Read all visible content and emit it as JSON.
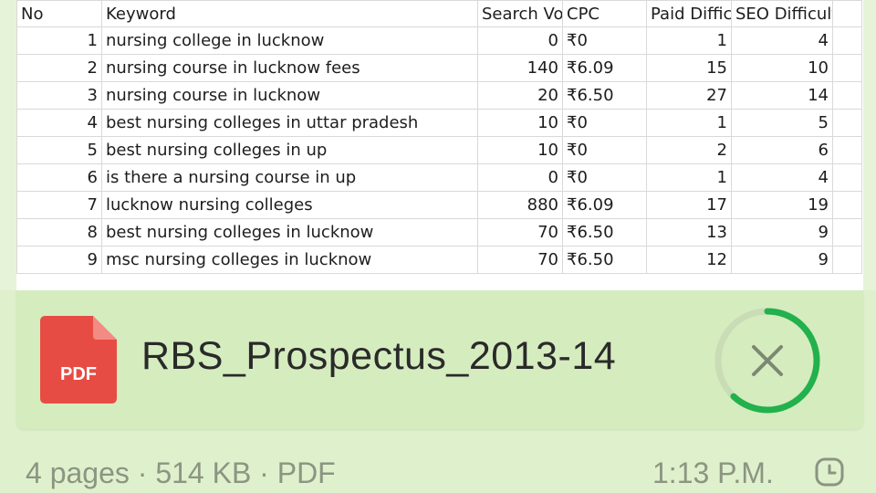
{
  "sheet": {
    "headers": [
      "No",
      "Keyword",
      "Search Vo",
      "CPC",
      "Paid Diffic",
      "SEO Difficulty"
    ],
    "rows": [
      [
        "1",
        "nursing college in lucknow",
        "0",
        "₹0",
        "1",
        "4"
      ],
      [
        "2",
        "nursing course in lucknow fees",
        "140",
        "₹6.09",
        "15",
        "10"
      ],
      [
        "3",
        "nursing course in lucknow",
        "20",
        "₹6.50",
        "27",
        "14"
      ],
      [
        "4",
        "best nursing colleges in uttar pradesh",
        "10",
        "₹0",
        "1",
        "5"
      ],
      [
        "5",
        "best nursing colleges in up",
        "10",
        "₹0",
        "2",
        "6"
      ],
      [
        "6",
        "is there a nursing course in up",
        "0",
        "₹0",
        "1",
        "4"
      ],
      [
        "7",
        "lucknow nursing colleges",
        "880",
        "₹6.09",
        "17",
        "19"
      ],
      [
        "8",
        "best nursing colleges in lucknow",
        "70",
        "₹6.50",
        "13",
        "9"
      ],
      [
        "9",
        "msc nursing colleges in lucknow",
        "70",
        "₹6.50",
        "12",
        "9"
      ]
    ]
  },
  "attachment": {
    "icon_label": "PDF",
    "file_name": "RBS_Prospectus_2013-14",
    "meta": "4 pages · 514 KB · PDF",
    "progress": 0.62,
    "cancel_icon": "close-icon"
  },
  "message": {
    "time": "1:13 P.M.",
    "status_icon": "clock-icon"
  },
  "colors": {
    "background": "#dff0cd",
    "card": "#d5ecbf",
    "pdf_red": "#e74c44",
    "progress_green": "#22b14c"
  }
}
